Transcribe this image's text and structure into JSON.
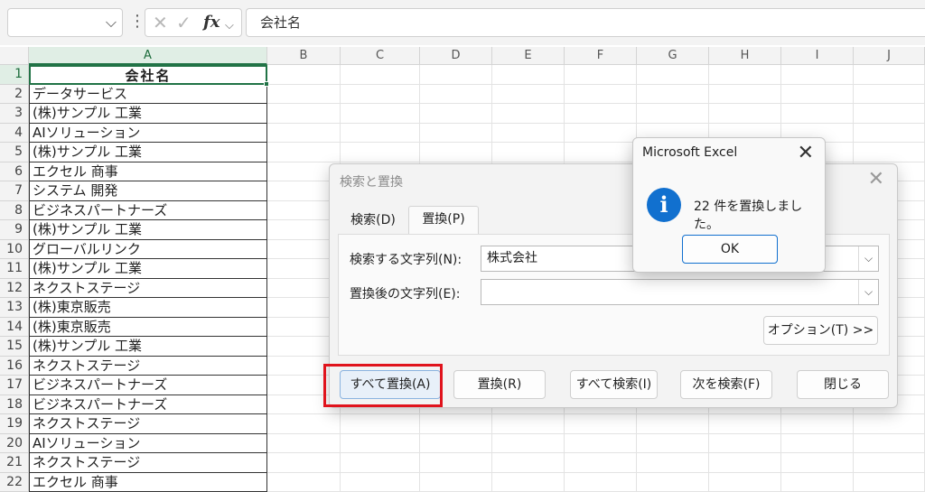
{
  "formula_bar": {
    "name_box": "",
    "dots": "⋮",
    "cancel_icon": "✕",
    "enter_icon": "✓",
    "fx_label": "fx",
    "value": "会社名"
  },
  "grid": {
    "columns": [
      "A",
      "B",
      "C",
      "D",
      "E",
      "F",
      "G",
      "H",
      "I",
      "J"
    ],
    "selected_column": "A",
    "rows": [
      "1",
      "2",
      "3",
      "4",
      "5",
      "6",
      "7",
      "8",
      "9",
      "10",
      "11",
      "12",
      "13",
      "14",
      "15",
      "16",
      "17",
      "18",
      "19",
      "20",
      "21",
      "22"
    ],
    "col_a": [
      "会社名",
      "データサービス",
      "(株)サンプル 工業",
      "AIソリューション",
      "(株)サンプル 工業",
      "エクセル 商事",
      "システム 開発",
      "ビジネスパートナーズ",
      "(株)サンプル 工業",
      "グローバルリンク",
      "(株)サンプル 工業",
      "ネクストステージ",
      "(株)東京販売",
      "(株)東京販売",
      "(株)サンプル 工業",
      "ネクストステージ",
      "ビジネスパートナーズ",
      "ビジネスパートナーズ",
      "ネクストステージ",
      "AIソリューション",
      "ネクストステージ",
      "エクセル 商事"
    ]
  },
  "find_replace": {
    "title": "検索と置換",
    "close": "✕",
    "tabs": {
      "find": "検索(D)",
      "replace": "置換(P)"
    },
    "find_label": "検索する文字列(N):",
    "find_value": "株式会社",
    "replace_label": "置換後の文字列(E):",
    "replace_value": "",
    "dropdown": "⌵",
    "buttons": {
      "options": "オプション(T) >>",
      "replace_all": "すべて置換(A)",
      "replace": "置換(R)",
      "find_all": "すべて検索(I)",
      "find_next": "次を検索(F)",
      "close": "閉じる"
    }
  },
  "message_box": {
    "title": "Microsoft Excel",
    "close": "✕",
    "icon": "i",
    "message": "22 件を置換しました。",
    "ok": "OK"
  },
  "colors": {
    "accent": "#217346",
    "info": "#1170cf",
    "highlight": "#e0131c"
  }
}
